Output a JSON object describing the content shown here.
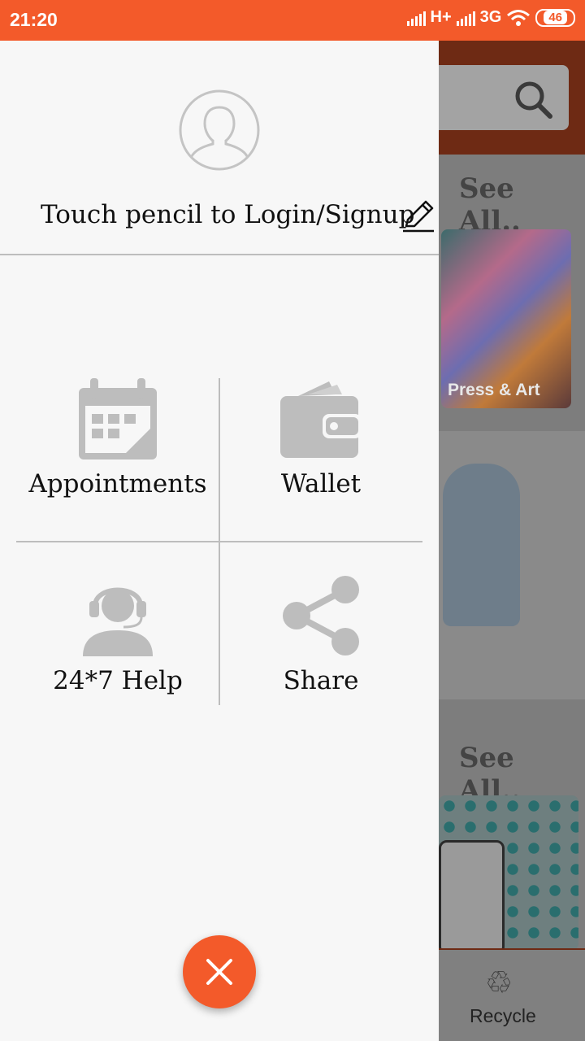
{
  "status_bar": {
    "time": "21:20",
    "network1": "H+",
    "network2": "3G",
    "battery": "46"
  },
  "background": {
    "see_all_1": "See All..",
    "card_label": "Press & Art",
    "see_all_2": "See All..",
    "nav_label": "Recycle"
  },
  "drawer": {
    "login_prompt": "Touch pencil to Login/Signup",
    "menu": [
      {
        "label": "Appointments",
        "icon": "calendar-icon"
      },
      {
        "label": "Wallet",
        "icon": "wallet-icon"
      },
      {
        "label": "24*7 Help",
        "icon": "support-agent-icon"
      },
      {
        "label": "Share",
        "icon": "share-icon"
      }
    ]
  },
  "colors": {
    "accent": "#F35A2A",
    "icon_gray": "#BDBDBD",
    "drawer_bg": "#F7F7F7"
  }
}
